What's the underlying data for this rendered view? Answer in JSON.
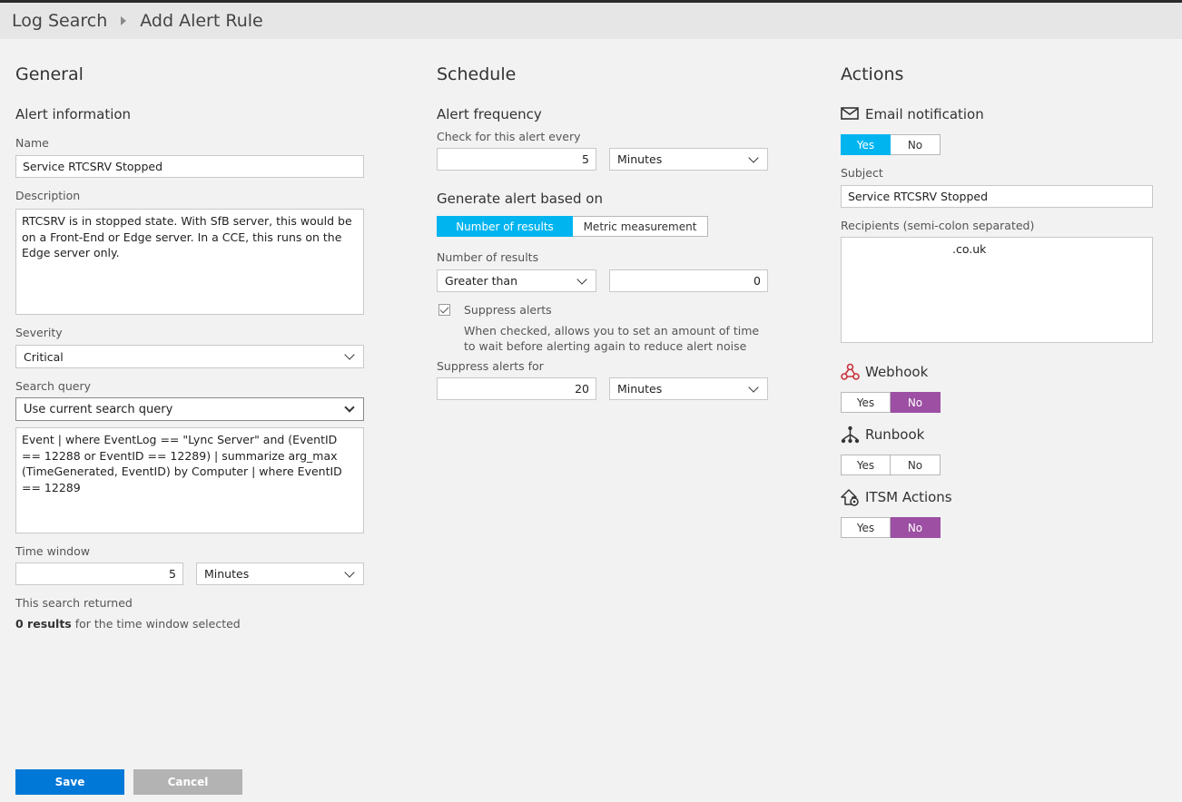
{
  "breadcrumb": {
    "parent": "Log Search",
    "current": "Add Alert Rule"
  },
  "general": {
    "title": "General",
    "alert_info_heading": "Alert information",
    "name_label": "Name",
    "name_value": "Service RTCSRV Stopped",
    "description_label": "Description",
    "description_value": "RTCSRV is in stopped state. With SfB server, this would be on a Front-End or Edge server. In a CCE, this runs on the Edge server only.",
    "severity_label": "Severity",
    "severity_value": "Critical",
    "search_query_label": "Search query",
    "search_query_mode": "Use current search query",
    "query_text": "Event | where EventLog == \"Lync Server\" and (EventID == 12288 or EventID == 12289) | summarize arg_max (TimeGenerated, EventID) by Computer | where EventID == 12289",
    "time_window_label": "Time window",
    "time_window_value": "5",
    "time_window_unit": "Minutes",
    "search_returned_label": "This search returned",
    "results_count": "0 results",
    "results_suffix": " for the time window selected"
  },
  "schedule": {
    "title": "Schedule",
    "frequency_heading": "Alert frequency",
    "check_label": "Check for this alert every",
    "check_value": "5",
    "check_unit": "Minutes",
    "generate_heading": "Generate alert based on",
    "basis_options": [
      "Number of results",
      "Metric measurement"
    ],
    "results_label": "Number of results",
    "operator_value": "Greater than",
    "threshold_value": "0",
    "suppress_label": "Suppress alerts",
    "suppress_help": "When checked, allows you to set an amount of time to wait before alerting again to reduce alert noise",
    "suppress_for_label": "Suppress alerts for",
    "suppress_for_value": "20",
    "suppress_for_unit": "Minutes"
  },
  "actions": {
    "title": "Actions",
    "email_heading": "Email notification",
    "subject_label": "Subject",
    "subject_value": "Service RTCSRV Stopped",
    "recipients_label": "Recipients (semi-colon separated)",
    "recipients_value": ".co.uk",
    "webhook_heading": "Webhook",
    "runbook_heading": "Runbook",
    "itsm_heading": "ITSM Actions",
    "yes_label": "Yes",
    "no_label": "No"
  },
  "footer": {
    "save_label": "Save",
    "cancel_label": "Cancel"
  },
  "colors": {
    "accent_blue": "#00b4f0",
    "accent_purple": "#9c4fa3",
    "save_blue": "#0078d7",
    "cancel_gray": "#b3b3b3"
  }
}
